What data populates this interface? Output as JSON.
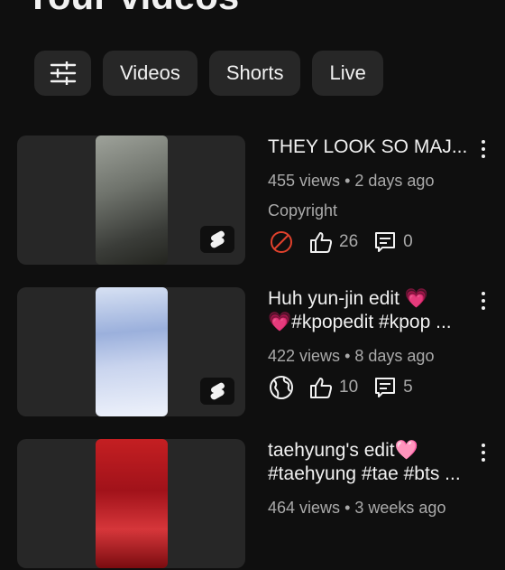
{
  "page": {
    "title": "Your videos"
  },
  "filters": {
    "chips": [
      {
        "label": "Videos"
      },
      {
        "label": "Shorts"
      },
      {
        "label": "Live"
      }
    ],
    "filter_icon": "sliders-icon"
  },
  "videos": [
    {
      "title_line1": "THEY LOOK SO MAJ...",
      "title_line2": "",
      "views": "455 views",
      "age": "2 days ago",
      "meta_sep": "•",
      "restriction": "Copyright",
      "visibility_icon": "blocked-icon",
      "likes": "26",
      "comments": "0",
      "colors": [
        "#8d918a",
        "#5b5e58",
        "#30322f"
      ]
    },
    {
      "title_line1": "Huh yun-jin edit 💗",
      "title_line2": "💗#kpopedit #kpop ...",
      "views": "422 views",
      "age": "8 days ago",
      "meta_sep": "•",
      "visibility_icon": "globe-icon",
      "likes": "10",
      "comments": "5",
      "colors": [
        "#c8d6ef",
        "#8fa7d8",
        "#e9eef8"
      ]
    },
    {
      "title_line1": "taehyung's edit🩷",
      "title_line2": "#taehyung #tae #bts ...",
      "views": "464 views",
      "age": "3 weeks ago",
      "meta_sep": "•",
      "colors": [
        "#b3131a",
        "#d9312c",
        "#6e0b0f"
      ]
    }
  ],
  "colors": {
    "background": "#0f0f0f",
    "chip": "#272727",
    "secondary_text": "#aaaaaa",
    "blocked": "#e0412c"
  }
}
